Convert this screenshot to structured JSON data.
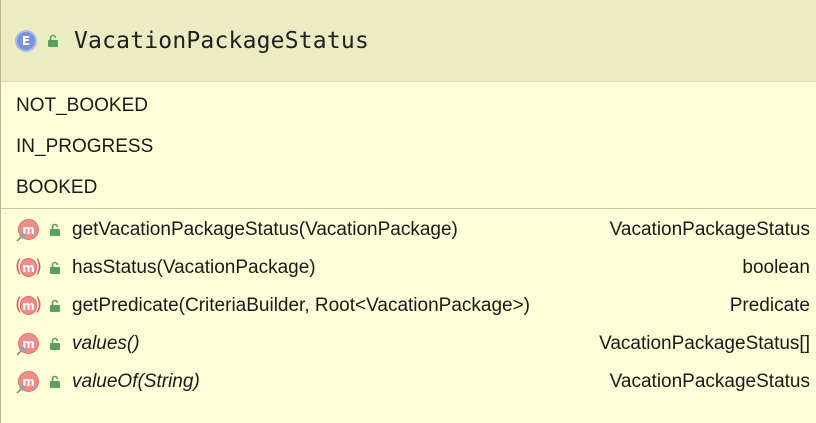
{
  "class": {
    "name": "VacationPackageStatus",
    "kind_badge": "E",
    "kind": "enum"
  },
  "constants": [
    "NOT_BOOKED",
    "IN_PROGRESS",
    "BOOKED"
  ],
  "methods": [
    {
      "icon": "method-icon",
      "icon_letter": "m",
      "signature": "getVacationPackageStatus(VacationPackage)",
      "return_type": "VacationPackageStatus"
    },
    {
      "icon": "abstract-method-icon",
      "icon_letter": "m",
      "signature": "hasStatus(VacationPackage)",
      "return_type": "boolean"
    },
    {
      "icon": "abstract-method-icon",
      "icon_letter": "m",
      "signature": "getPredicate(CriteriaBuilder, Root<VacationPackage>)",
      "return_type": "Predicate"
    },
    {
      "icon": "method-icon",
      "icon_letter": "m",
      "signature": "values()",
      "return_type": "VacationPackageStatus[]"
    },
    {
      "icon": "method-icon",
      "icon_letter": "m",
      "signature": "valueOf(String)",
      "return_type": "VacationPackageStatus"
    }
  ],
  "colors": {
    "header_bg": "#ebebc4",
    "body_bg": "#fefed9",
    "enum_badge": "#7c93db",
    "method_icon": "#f08c8c",
    "public_visibility": "#5aa05a"
  }
}
